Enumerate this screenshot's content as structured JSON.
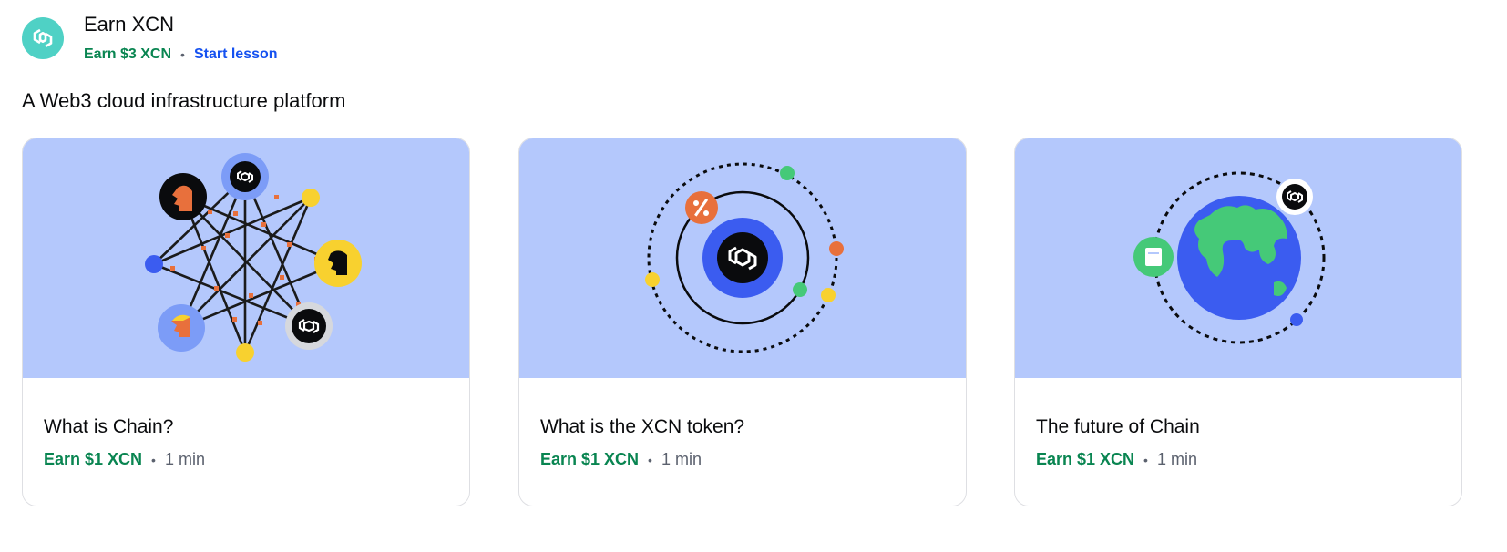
{
  "header": {
    "title": "Earn XCN",
    "reward": "Earn $3 XCN",
    "separator": "•",
    "action": "Start lesson",
    "logo_icon": "chain-logo-icon",
    "logo_color": "#4fd1c5"
  },
  "description": "A Web3 cloud infrastructure platform",
  "colors": {
    "accent": "#1652f0",
    "reward": "#098551",
    "illustration_bg": "#b4c8fc"
  },
  "lessons": [
    {
      "title": "What is Chain?",
      "reward": "Earn $1 XCN",
      "separator": "•",
      "duration": "1 min",
      "illustration": "network-star-illustration"
    },
    {
      "title": "What is the XCN token?",
      "reward": "Earn $1 XCN",
      "separator": "•",
      "duration": "1 min",
      "illustration": "token-orbit-illustration"
    },
    {
      "title": "The future of Chain",
      "reward": "Earn $1 XCN",
      "separator": "•",
      "duration": "1 min",
      "illustration": "globe-orbit-illustration"
    }
  ]
}
